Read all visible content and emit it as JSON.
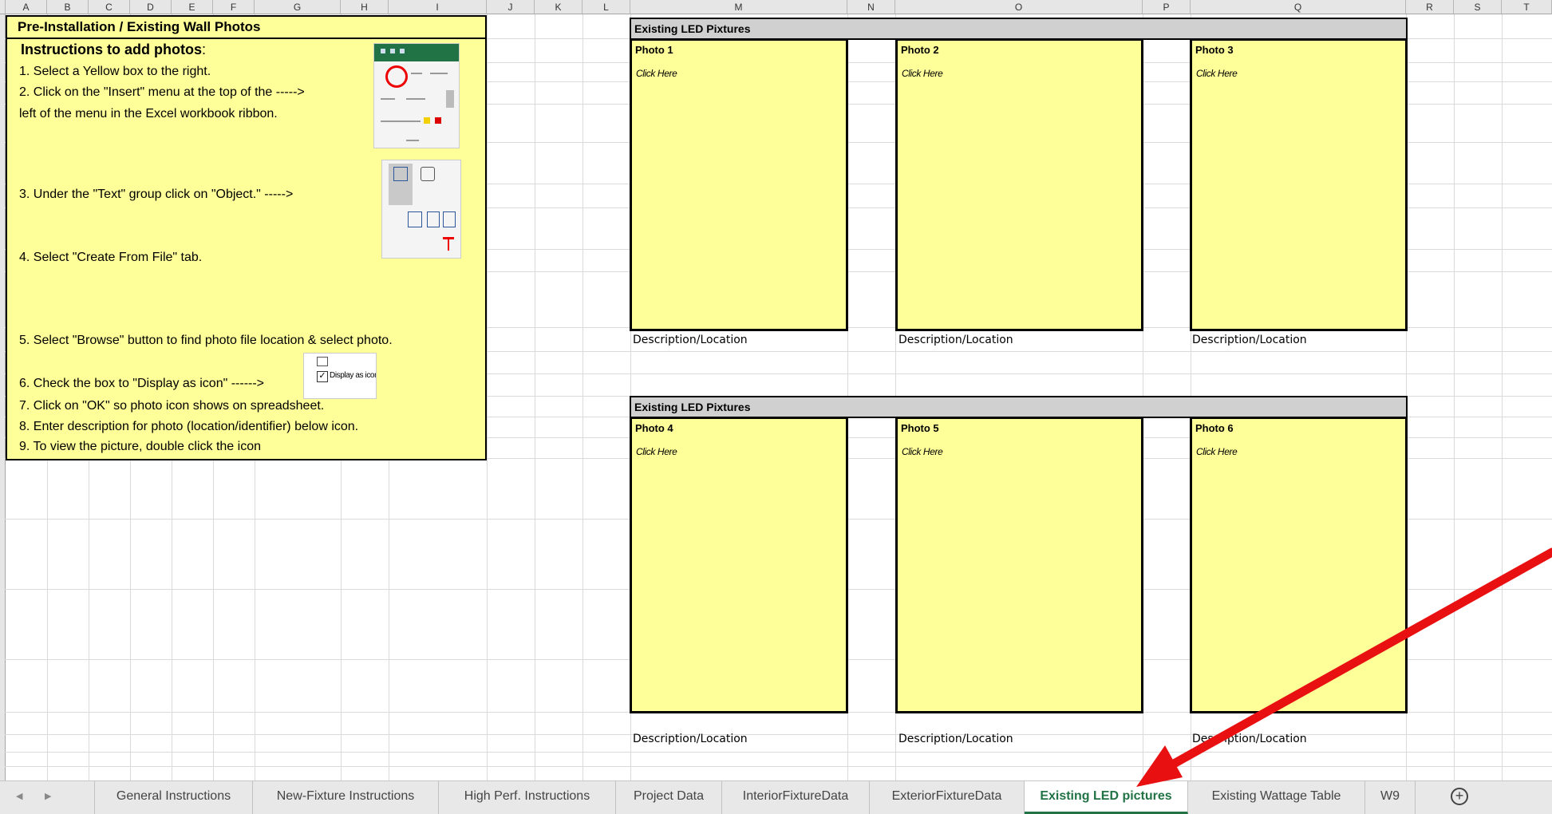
{
  "columns": [
    "A",
    "B",
    "C",
    "D",
    "E",
    "F",
    "G",
    "H",
    "I",
    "J",
    "K",
    "L",
    "M",
    "N",
    "O",
    "P",
    "Q",
    "R",
    "S",
    "T"
  ],
  "instructions": {
    "title": "Pre-Installation / Existing Wall Photos",
    "heading": "Instructions to add photos",
    "heading_colon": ":",
    "steps": [
      "1. Select a Yellow box to the right.",
      "2. Click on the \"Insert\" menu at the top of the ----->",
      "left of the menu in the Excel workbook ribbon.",
      "3. Under the \"Text\" group click on \"Object.\"  ----->",
      "4. Select \"Create From File\" tab.",
      "5. Select \"Browse\" button to find photo file location & select photo.",
      "6. Check the box to \"Display as icon\" ------>",
      "7. Click on \"OK\" so photo icon shows on spreadsheet.",
      "8. Enter description for photo (location/identifier) below icon.",
      "9. To view the picture, double click the icon"
    ],
    "thumb_display_as_icon": "Display as icon"
  },
  "sections": [
    {
      "banner": "Existing LED Pixtures",
      "photos": [
        {
          "title": "Photo 1",
          "click": "Click Here",
          "desc": "Description/Location"
        },
        {
          "title": "Photo 2",
          "click": "Click Here",
          "desc": "Description/Location"
        },
        {
          "title": "Photo 3",
          "click": "Click Here",
          "desc": "Description/Location"
        }
      ]
    },
    {
      "banner": "Existing LED Pixtures",
      "photos": [
        {
          "title": "Photo 4",
          "click": "Click Here",
          "desc": "Description/Location"
        },
        {
          "title": "Photo 5",
          "click": "Click Here",
          "desc": "Description/Location"
        },
        {
          "title": "Photo 6",
          "click": "Click Here",
          "desc": "Description/Location"
        }
      ]
    }
  ],
  "tabs": [
    "General Instructions",
    "New-Fixture Instructions",
    "High Perf. Instructions",
    "Project Data",
    "InteriorFixtureData",
    "ExteriorFixtureData",
    "Existing LED pictures",
    "Existing Wattage Table",
    "W9"
  ],
  "active_tab": "Existing LED pictures",
  "colors": {
    "photo_fill": "#ffff99",
    "active_tab_text": "#217346",
    "arrow": "#e81010"
  }
}
